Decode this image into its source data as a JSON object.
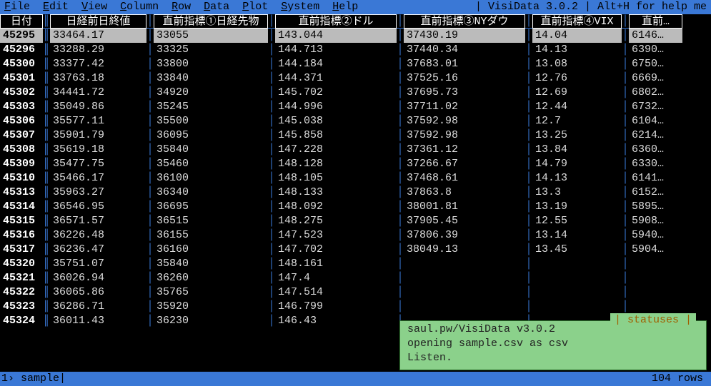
{
  "menu": {
    "items": [
      {
        "u": "F",
        "rest": "ile"
      },
      {
        "u": "E",
        "rest": "dit"
      },
      {
        "u": "V",
        "rest": "iew"
      },
      {
        "u": "C",
        "rest": "olumn"
      },
      {
        "u": "R",
        "rest": "ow"
      },
      {
        "u": "D",
        "rest": "ata"
      },
      {
        "u": "P",
        "rest": "lot"
      },
      {
        "u": "S",
        "rest": "ystem"
      },
      {
        "u": "H",
        "rest": "elp"
      }
    ],
    "title": "| VisiData 3.0.2 | Alt+H for help me"
  },
  "headers": [
    "日付",
    "日経前日終値",
    "直前指標①日経先物",
    "直前指標②ドル",
    "直前指標③NYダウ",
    "直前指標④VIX",
    "直前…"
  ],
  "rows": [
    [
      "45295",
      "33464.17",
      "33055",
      "143.044",
      "37430.19",
      "14.04",
      "6146…"
    ],
    [
      "45296",
      "33288.29",
      "33325",
      "144.713",
      "37440.34",
      "14.13",
      "6390…"
    ],
    [
      "45300",
      "33377.42",
      "33800",
      "144.184",
      "37683.01",
      "13.08",
      "6750…"
    ],
    [
      "45301",
      "33763.18",
      "33840",
      "144.371",
      "37525.16",
      "12.76",
      "6669…"
    ],
    [
      "45302",
      "34441.72",
      "34920",
      "145.702",
      "37695.73",
      "12.69",
      "6802…"
    ],
    [
      "45303",
      "35049.86",
      "35245",
      "144.996",
      "37711.02",
      "12.44",
      "6732…"
    ],
    [
      "45306",
      "35577.11",
      "35500",
      "145.038",
      "37592.98",
      "12.7",
      "6104…"
    ],
    [
      "45307",
      "35901.79",
      "36095",
      "145.858",
      "37592.98",
      "13.25",
      "6214…"
    ],
    [
      "45308",
      "35619.18",
      "35840",
      "147.228",
      "37361.12",
      "13.84",
      "6360…"
    ],
    [
      "45309",
      "35477.75",
      "35460",
      "148.128",
      "37266.67",
      "14.79",
      "6330…"
    ],
    [
      "45310",
      "35466.17",
      "36100",
      "148.105",
      "37468.61",
      "14.13",
      "6141…"
    ],
    [
      "45313",
      "35963.27",
      "36340",
      "148.133",
      "37863.8",
      "13.3",
      "6152…"
    ],
    [
      "45314",
      "36546.95",
      "36695",
      "148.092",
      "38001.81",
      "13.19",
      "5895…"
    ],
    [
      "45315",
      "36571.57",
      "36515",
      "148.275",
      "37905.45",
      "12.55",
      "5908…"
    ],
    [
      "45316",
      "36226.48",
      "36155",
      "147.523",
      "37806.39",
      "13.14",
      "5940…"
    ],
    [
      "45317",
      "36236.47",
      "36160",
      "147.702",
      "38049.13",
      "13.45",
      "5904…"
    ],
    [
      "45320",
      "35751.07",
      "35840",
      "148.161",
      "",
      "",
      ""
    ],
    [
      "45321",
      "36026.94",
      "36260",
      "147.4",
      "",
      "",
      ""
    ],
    [
      "45322",
      "36065.86",
      "35765",
      "147.514",
      "",
      "",
      ""
    ],
    [
      "45323",
      "36286.71",
      "35920",
      "146.799",
      "",
      "",
      ""
    ],
    [
      "45324",
      "36011.43",
      "36230",
      "146.43",
      "",
      "",
      ""
    ]
  ],
  "selected_row_index": 0,
  "status": {
    "left": "1› sample|",
    "right": "104 rows "
  },
  "popup": {
    "title": " statuses ",
    "lines": [
      "saul.pw/VisiData v3.0.2",
      "opening sample.csv as csv",
      "Listen."
    ]
  }
}
